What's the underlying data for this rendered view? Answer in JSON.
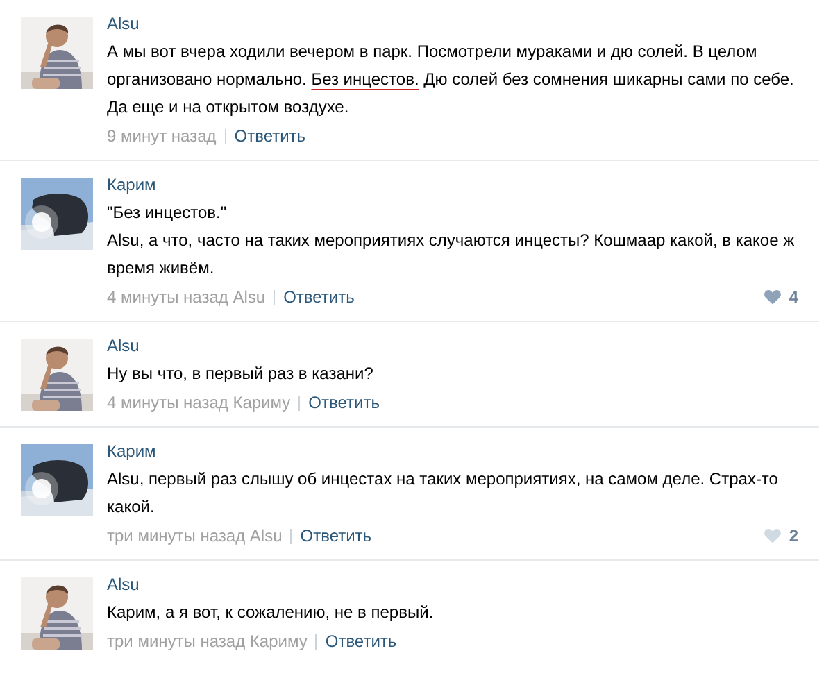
{
  "comments": [
    {
      "author": "Alsu",
      "text": [
        {
          "t": "А мы вот вчера ходили вечером в парк. Посмотрели мураками и дю солей. В целом организовано нормально. ",
          "underlined": false
        },
        {
          "t": "Без инцестов.",
          "underlined": true
        },
        {
          "t": " Дю солей без сомнения шикарны сами по себе. Да еще и на открытом воздухе.",
          "underlined": false
        }
      ],
      "meta": "9 минут назад",
      "reply": "Ответить"
    },
    {
      "author": "Карим",
      "text": [
        {
          "t": "\"Без инцестов.\"\nAlsu, а что, часто на таких мероприятиях случаются инцесты? Кошмаар какой, в какое ж время живём.",
          "underlined": false
        }
      ],
      "meta": "4 минуты назад Alsu",
      "reply": "Ответить",
      "likes": {
        "count": "4",
        "liked": true
      }
    },
    {
      "author": "Alsu",
      "text": [
        {
          "t": "Ну вы что, в первый раз в казани?",
          "underlined": false
        }
      ],
      "meta": "4 минуты назад Кариму",
      "reply": "Ответить"
    },
    {
      "author": "Карим",
      "text": [
        {
          "t": "Alsu, первый раз слышу об инцестах на таких мероприятиях, на самом деле. Страх-то какой.",
          "underlined": false
        }
      ],
      "meta": "три минуты назад Alsu",
      "reply": "Ответить",
      "likes": {
        "count": "2",
        "liked": false
      }
    },
    {
      "author": "Alsu",
      "text": [
        {
          "t": "Карим, а я вот, к сожалению, не в первый.",
          "underlined": false
        }
      ],
      "meta": "три минуты назад Кариму",
      "reply": "Ответить"
    }
  ]
}
